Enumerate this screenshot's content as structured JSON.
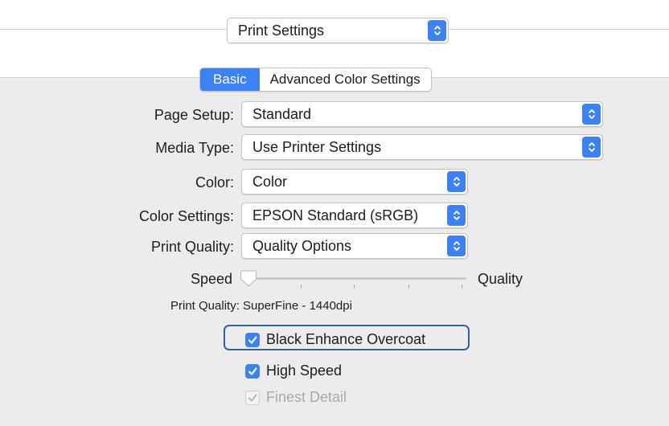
{
  "header": {
    "preset_menu": "Print Settings"
  },
  "tabs": [
    {
      "label": "Basic",
      "active": true
    },
    {
      "label": "Advanced Color Settings",
      "active": false
    }
  ],
  "fields": {
    "page_setup": {
      "label": "Page Setup:",
      "value": "Standard"
    },
    "media_type": {
      "label": "Media Type:",
      "value": "Use Printer Settings"
    },
    "color": {
      "label": "Color:",
      "value": "Color"
    },
    "color_settings": {
      "label": "Color Settings:",
      "value": "EPSON Standard (sRGB)"
    },
    "print_quality": {
      "label": "Print Quality:",
      "value": "Quality Options"
    }
  },
  "slider": {
    "left_label": "Speed",
    "right_label": "Quality",
    "level": 0
  },
  "print_quality_info": "Print Quality: SuperFine - 1440dpi",
  "checkboxes": [
    {
      "label": "Black Enhance Overcoat",
      "checked": true,
      "disabled": false,
      "highlighted": true
    },
    {
      "label": "High Speed",
      "checked": true,
      "disabled": false,
      "highlighted": false
    },
    {
      "label": "Finest Detail",
      "checked": true,
      "disabled": true,
      "highlighted": false
    }
  ],
  "colors": {
    "accent": "#3c82f7",
    "panel": "#ececec",
    "highlight_border": "#2f62a7"
  }
}
